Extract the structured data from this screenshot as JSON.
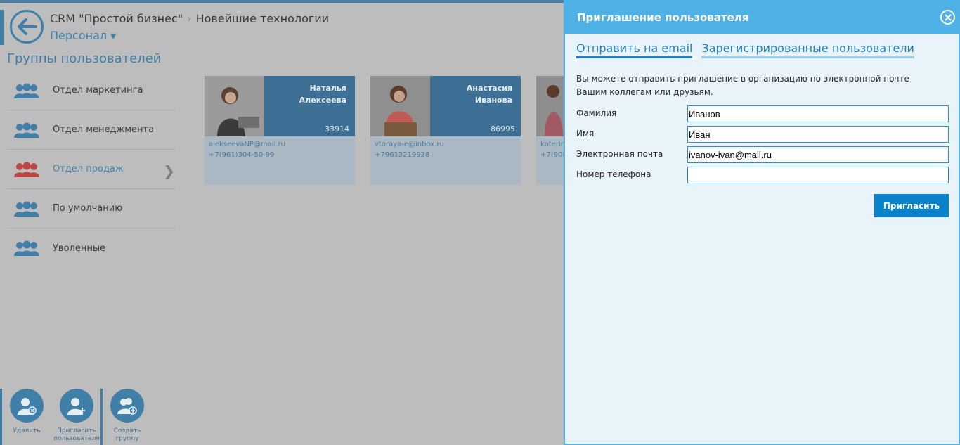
{
  "breadcrumb": {
    "app": "CRM \"Простой бизнес\"",
    "org": "Новейшие технологии"
  },
  "section": {
    "label": "Персонал",
    "arrow": "▾"
  },
  "groups": {
    "title": "Группы пользователей",
    "items": [
      {
        "label": "Отдел маркетинга",
        "active": false
      },
      {
        "label": "Отдел менеджмента",
        "active": false
      },
      {
        "label": "Отдел продаж",
        "active": true
      },
      {
        "label": "По умолчанию",
        "active": false
      },
      {
        "label": "Уволенные",
        "active": false
      }
    ]
  },
  "users": [
    {
      "name_first": "Наталья",
      "name_last": "Алексеева",
      "number": "33914",
      "email": "alekseevaNP@mail.ru",
      "phone": "+7(961)304-50-99"
    },
    {
      "name_first": "Анастасия",
      "name_last": "Иванова",
      "number": "86995",
      "email": "vtoraya-e@inbox.ru",
      "phone": "+79613219928"
    },
    {
      "name_first": "",
      "name_last": "",
      "number": "",
      "email": "katerin",
      "phone": "+7(908"
    }
  ],
  "actions": {
    "delete": "Удалить",
    "invite_line1": "Пригласить",
    "invite_line2": "пользователя",
    "create_group": "Создать группу"
  },
  "invite_panel": {
    "title": "Приглашение пользователя",
    "tabs": [
      "Отправить на email",
      "Зарегистрированные пользователи"
    ],
    "intro": "Вы можете отправить приглашение в организацию по электронной почте Вашим коллегам или друзьям.",
    "fields": {
      "last_name": {
        "label": "Фамилия",
        "value": "Иванов"
      },
      "first_name": {
        "label": "Имя",
        "value": "Иван"
      },
      "email": {
        "label": "Электронная почта",
        "value": "ivanov-ivan@mail.ru"
      },
      "phone": {
        "label": "Номер телефона",
        "value": ""
      }
    },
    "submit_label": "Пригласить"
  },
  "colors": {
    "accent": "#4fb2e6",
    "button": "#0a82c9",
    "active_group": "#d23c3c",
    "group_icon": "#3f7fa8"
  }
}
